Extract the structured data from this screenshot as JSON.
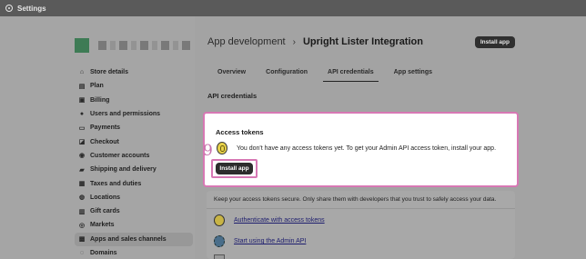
{
  "window": {
    "title": "Settings",
    "icon": "gear-icon"
  },
  "sidebar": {
    "items": [
      {
        "label": "Store details",
        "icon": "store-icon"
      },
      {
        "label": "Plan",
        "icon": "plan-icon"
      },
      {
        "label": "Billing",
        "icon": "billing-icon"
      },
      {
        "label": "Users and permissions",
        "icon": "users-icon"
      },
      {
        "label": "Payments",
        "icon": "payments-icon"
      },
      {
        "label": "Checkout",
        "icon": "checkout-icon"
      },
      {
        "label": "Customer accounts",
        "icon": "customer-icon"
      },
      {
        "label": "Shipping and delivery",
        "icon": "truck-icon"
      },
      {
        "label": "Taxes and duties",
        "icon": "tax-icon"
      },
      {
        "label": "Locations",
        "icon": "location-icon"
      },
      {
        "label": "Gift cards",
        "icon": "gift-card-icon"
      },
      {
        "label": "Markets",
        "icon": "globe-icon"
      },
      {
        "label": "Apps and sales channels",
        "icon": "apps-icon"
      },
      {
        "label": "Domains",
        "icon": "domain-icon"
      }
    ]
  },
  "header": {
    "crumb_parent": "App development",
    "crumb_sep": "›",
    "crumb_current": "Upright Lister Integration",
    "install_label": "Install app"
  },
  "tabs": [
    {
      "label": "Overview"
    },
    {
      "label": "Configuration"
    },
    {
      "label": "API credentials"
    },
    {
      "label": "App settings"
    }
  ],
  "section_title": "API credentials",
  "access_tokens": {
    "title": "Access tokens",
    "message": "You don't have any access tokens yet. To get your Admin API access token, install your app.",
    "button_label": "Install app",
    "step_number": "9"
  },
  "security": {
    "note": "Keep your access tokens secure. Only share them with developers that you trust to safely access your data.",
    "links": [
      {
        "label": "Authenticate with access tokens",
        "icon": "token-icon"
      },
      {
        "label": "Start using the Admin API",
        "icon": "api-gear-icon"
      }
    ]
  },
  "colors": {
    "highlight": "#d778b4",
    "primary_button": "#2d2d2d",
    "brand_green": "#3e7b55"
  }
}
